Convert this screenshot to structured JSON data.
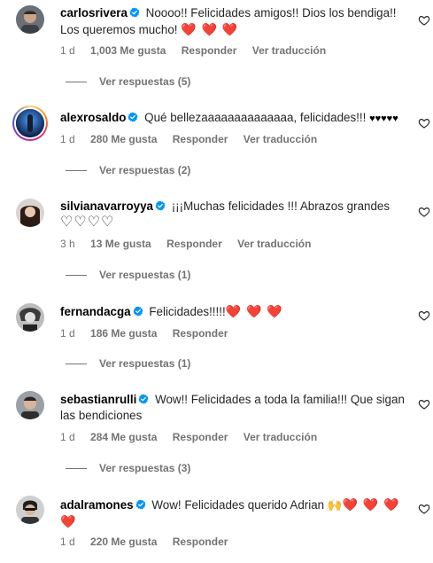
{
  "comments": [
    {
      "username": "carlosrivera",
      "text": "Noooo!! Felicidades amigos!! Dios los bendiga!! Los queremos mucho!",
      "hearts": "❤️ ❤️ ❤️",
      "time": "1 d",
      "likes": "1,003 Me gusta",
      "reply": "Responder",
      "translate": "Ver traducción",
      "replies": "Ver respuestas (5)"
    },
    {
      "username": "alexrosaldo",
      "text": "Qué bellezaaaaaaaaaaaaaa, felicidades!!!",
      "hearts": "♥♥♥♥♥",
      "time": "1 d",
      "likes": "280 Me gusta",
      "reply": "Responder",
      "translate": "Ver traducción",
      "replies": "Ver respuestas (2)"
    },
    {
      "username": "silvianavarroyya",
      "text": "¡¡¡Muchas felicidades !!! Abrazos grandes",
      "hearts": "♡♡♡♡",
      "time": "3 h",
      "likes": "13 Me gusta",
      "reply": "Responder",
      "translate": "Ver traducción",
      "replies": "Ver respuestas (1)"
    },
    {
      "username": "fernandacga",
      "text": "Felicidades!!!!!",
      "hearts": "❤️ ❤️ ❤️",
      "time": "1 d",
      "likes": "186 Me gusta",
      "reply": "Responder",
      "replies": "Ver respuestas (1)"
    },
    {
      "username": "sebastianrulli",
      "text": "Wow!! Felicidades a toda la familia!!! Que sigan las bendiciones",
      "time": "1 d",
      "likes": "284 Me gusta",
      "reply": "Responder",
      "translate": "Ver traducción",
      "replies": "Ver respuestas (3)"
    },
    {
      "username": "adalramones",
      "text": "Wow! Felicidades querido Adrian",
      "emoji": "🙌",
      "hearts": "❤️ ❤️ ❤️",
      "hearts2": "❤️",
      "time": "1 d",
      "likes": "220 Me gusta",
      "reply": "Responder"
    }
  ],
  "colors": {
    "verified": "#0095f6",
    "meta": "#737373",
    "heart_red": "#e0102a"
  }
}
